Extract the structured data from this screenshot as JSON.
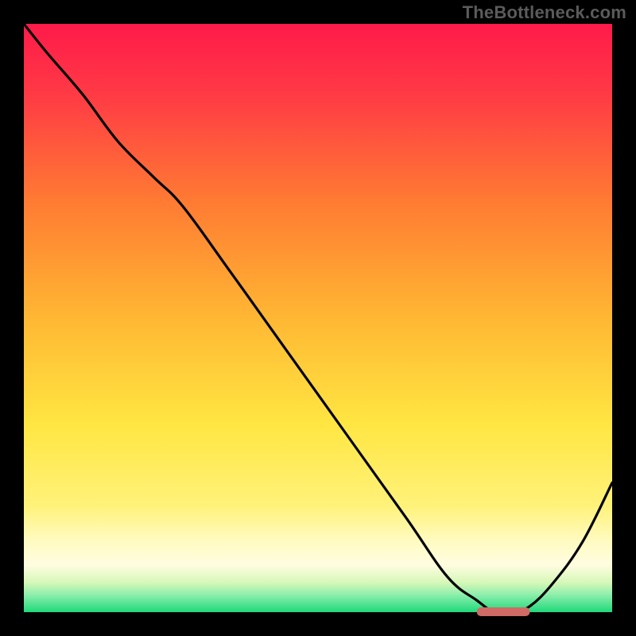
{
  "watermark": "TheBottleneck.com",
  "colors": {
    "background_black": "#000000",
    "gradient_top": "#ff1a4a",
    "gradient_mid_orange": "#ff9a2a",
    "gradient_yellow": "#ffe642",
    "gradient_pale_yellow": "#fffccf",
    "gradient_green": "#1fd97a",
    "curve_stroke": "#000000",
    "accent_bar": "#d06a64",
    "watermark": "#5b5b5b"
  },
  "chart_data": {
    "type": "line",
    "title": "",
    "xlabel": "",
    "ylabel": "",
    "xlim": [
      0,
      100
    ],
    "ylim": [
      0,
      100
    ],
    "series": [
      {
        "name": "bottleneck-curve",
        "x": [
          0,
          4,
          10,
          16,
          22,
          27,
          35,
          45,
          55,
          65,
          72,
          77,
          80,
          83,
          86,
          90,
          95,
          100
        ],
        "y": [
          100,
          95,
          88,
          80,
          74,
          69,
          58,
          44,
          30,
          16,
          6,
          2,
          0,
          0,
          1,
          5,
          12,
          22
        ]
      }
    ],
    "optimal_band": {
      "x_start": 77,
      "x_end": 86,
      "y": 0
    }
  }
}
